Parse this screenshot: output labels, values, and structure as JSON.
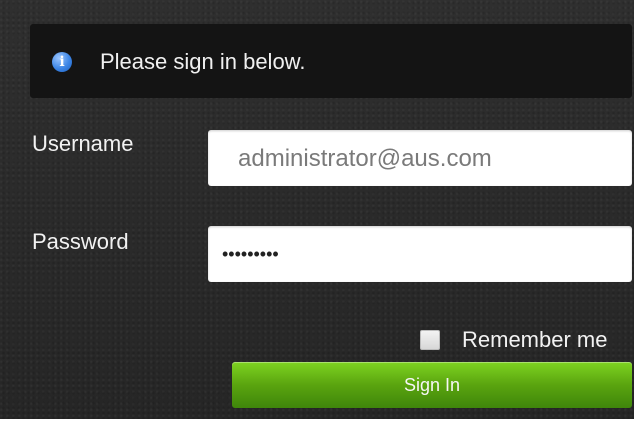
{
  "notice": {
    "icon": "info-icon",
    "icon_glyph": "i",
    "text": "Please sign in below."
  },
  "form": {
    "username_label": "Username",
    "username_value": "administrator@aus.com",
    "password_label": "Password",
    "password_mask": "•••••••••",
    "remember_label": "Remember me",
    "remember_checked": false,
    "sign_in_label": "Sign In"
  },
  "colors": {
    "background": "#2b2b2b",
    "notice_background": "#141414",
    "info_icon": "#3d86e6",
    "button_green": "#5aa40f"
  }
}
